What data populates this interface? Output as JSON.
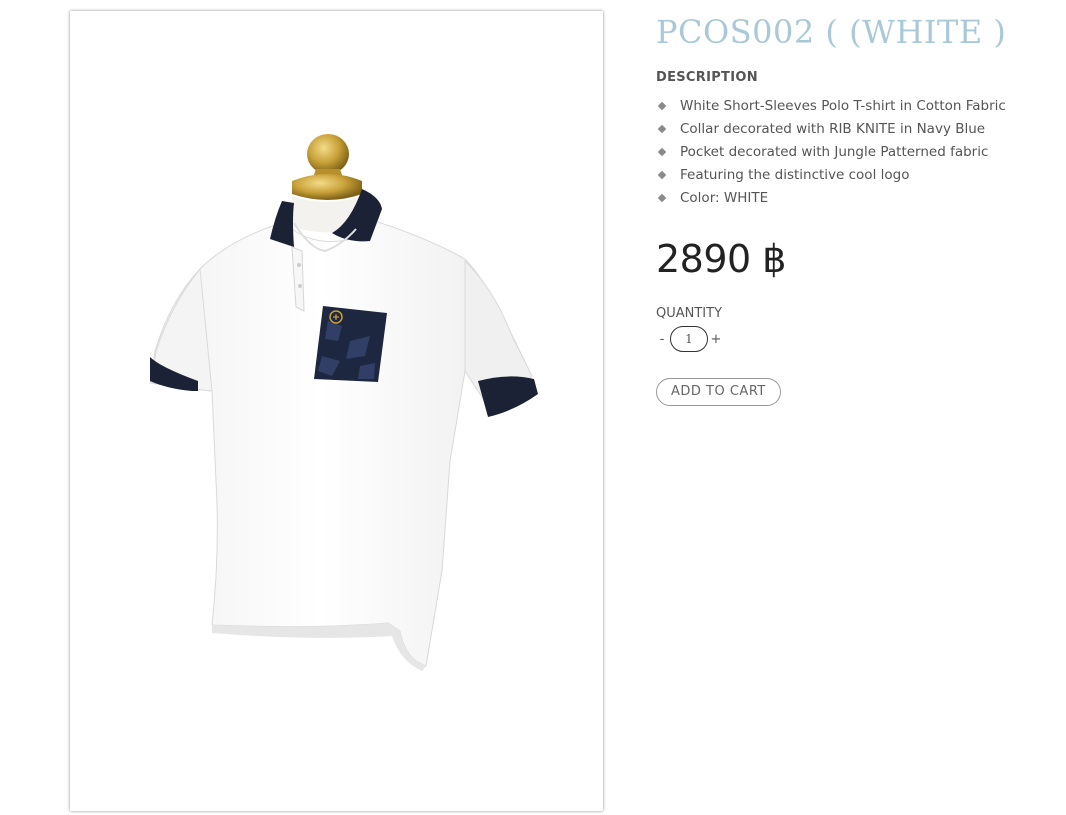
{
  "product": {
    "title": "PCOS002 ( (WHITE )",
    "description_heading": "DESCRIPTION",
    "description_items": [
      "White Short-Sleeves Polo T-shirt in Cotton Fabric",
      "Collar decorated with RIB KNITE in Navy Blue",
      "Pocket decorated with Jungle Patterned fabric",
      "Featuring the distinctive cool logo",
      "Color: WHITE"
    ],
    "price": "2890 ฿",
    "quantity_label": "QUANTITY",
    "quantity_minus": "-",
    "quantity_value": "1",
    "quantity_plus": "+",
    "add_to_cart_label": "ADD TO CART"
  },
  "image": {
    "subject": "white-polo-shirt-on-mannequin"
  },
  "colors": {
    "title": "#a9c9d8",
    "text": "#555555",
    "price": "#222222",
    "navy": "#1c2235",
    "gold": "#c9a23a"
  }
}
